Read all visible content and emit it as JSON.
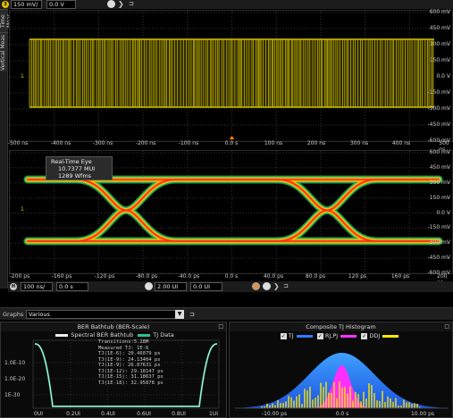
{
  "toolbar": {
    "channel_badge": "3",
    "scale_value": "150 mV/",
    "offset_value": "0.0 V"
  },
  "side_tabs": [
    "Vertical Meas",
    "Time Meas"
  ],
  "top_plot": {
    "y_labels": [
      "600 mV",
      "450 mV",
      "300 mV",
      "150 mV",
      "0.0 V",
      "-150 mV",
      "-300 mV",
      "-450 mV",
      "-600 mV"
    ],
    "x_labels": [
      "-500 ns",
      "-400 ns",
      "-300 ns",
      "-200 ns",
      "-100 ns",
      "0.0 s",
      "100 ns",
      "200 ns",
      "300 ns",
      "400 ns",
      "500 ns"
    ],
    "marker": "1",
    "trace_color": "#d4c200"
  },
  "eye_plot": {
    "info": {
      "title": "Real-Time Eye",
      "value": "10.7377 MUI",
      "count": "1289 Wfms"
    },
    "y_labels": [
      "600 mV",
      "450 mV",
      "300 mV",
      "150 mV",
      "0.0 V",
      "-150 mV",
      "-300 mV",
      "-450 mV",
      "-600 mV"
    ],
    "x_labels": [
      "-200 ps",
      "-160 ps",
      "-120 ps",
      "-80.0 ps",
      "-40.0 ps",
      "0.0 s",
      "40.0 ps",
      "80.0 ps",
      "120 ps",
      "160 ps",
      "200 ps"
    ],
    "marker": "1"
  },
  "bottom_toolbar": {
    "badge": "H",
    "timebase": "100 ns/",
    "position": "0.0 s",
    "ui_scale": "2.00 UI",
    "ui_position": "0.0 UI"
  },
  "graphs_bar": {
    "label": "Graphs",
    "selected": "Various"
  },
  "bathtub": {
    "title": "BER Bathtub (BER-Scale)",
    "legend": [
      "Spectral BER Bathtub",
      "TJ Data"
    ],
    "stats": [
      "Transitions:5.28M",
      "Measured TJ: 1E-6",
      "TJ(1E-6): 20.46079 ps",
      "TJ(1E-9): 24.13404 ps",
      "TJ(1E-9): 26.87631 ps",
      "TJ(1E-12): 29.18147 ps",
      "TJ(1E-15): 31.18637 ps",
      "TJ(1E-18): 32.95878 ps"
    ],
    "y_labels": [
      "1.0E-10",
      "1.0E-20",
      "1E-30"
    ],
    "x_labels": [
      "0UI",
      "0.2UI",
      "0.4UI",
      "0.6UI",
      "0.8UI",
      "1UI"
    ]
  },
  "histogram": {
    "title": "Composite TJ Histogram",
    "legend": [
      {
        "label": "TJ",
        "color": "#2f7bff"
      },
      {
        "label": "RJ,PJ",
        "color": "#ff30ff"
      },
      {
        "label": "DDJ",
        "color": "#ffe600"
      }
    ],
    "x_labels": [
      "-10.00 ps",
      "0.0 s",
      "10.00 ps"
    ]
  }
}
